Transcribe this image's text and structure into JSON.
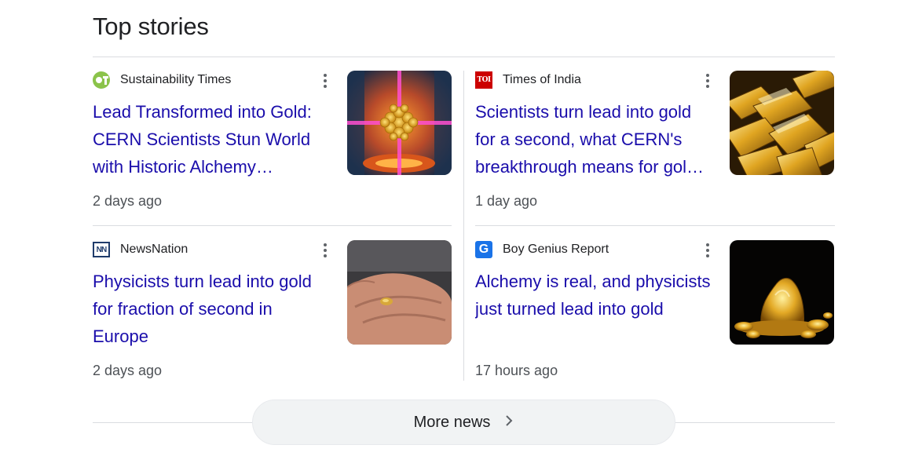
{
  "section": {
    "title": "Top stories"
  },
  "stories": [
    {
      "source": "Sustainability Times",
      "favicon": "sustainability-times-logo",
      "headline": "Lead Transformed into Gold: CERN Scientists Stun World with Historic Alchemy…",
      "age": "2 days ago",
      "thumbnail": "gold-atom-particle-accelerator"
    },
    {
      "source": "Times of India",
      "favicon": "times-of-india-logo",
      "favicon_text": "TOI",
      "headline": "Scientists turn lead into gold for a second, what CERN's breakthrough means for gol…",
      "age": "1 day ago",
      "thumbnail": "gold-bars-pile"
    },
    {
      "source": "NewsNation",
      "favicon": "newsnation-logo",
      "favicon_text": "NN",
      "headline": "Physicists turn lead into gold for fraction of second in Europe",
      "age": "2 days ago",
      "thumbnail": "hand-holding-gold-nugget"
    },
    {
      "source": "Boy Genius Report",
      "favicon": "bgr-logo",
      "favicon_text": "G",
      "headline": "Alchemy is real, and physicists just turned lead into gold",
      "age": "17 hours ago",
      "thumbnail": "gold-nuggets-dark"
    }
  ],
  "more": {
    "label": "More news"
  },
  "colors": {
    "link": "#1a0dab",
    "meta": "#4d5156",
    "divider": "#dadce0",
    "button_bg": "#f1f3f4"
  }
}
